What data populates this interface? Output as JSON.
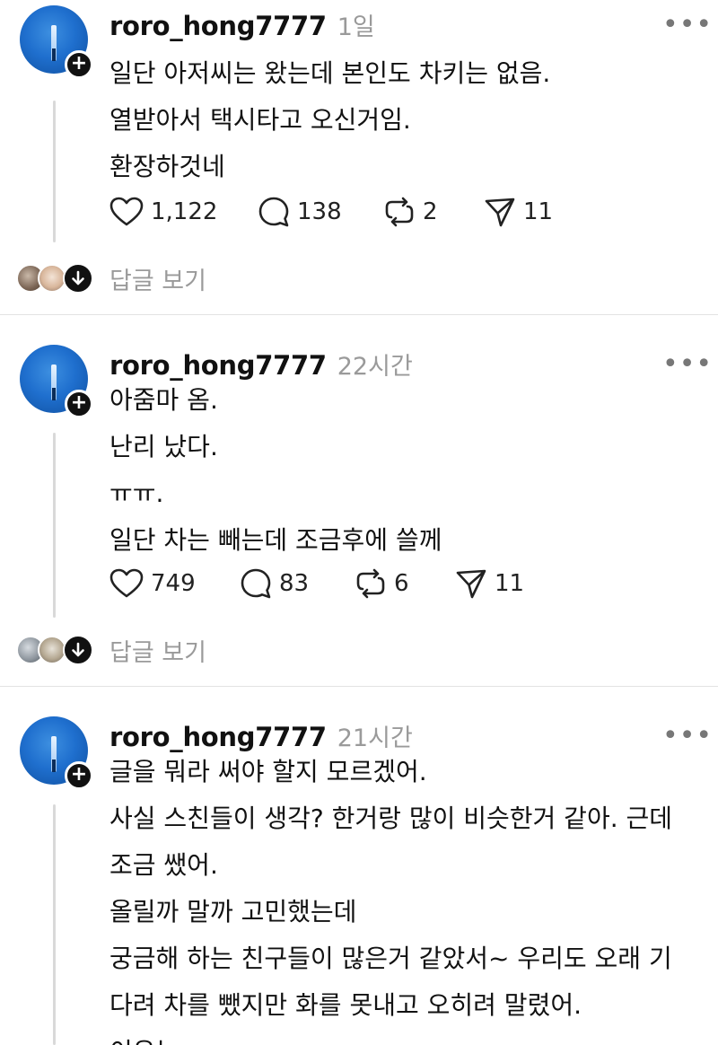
{
  "posts": [
    {
      "username": "roro_hong7777",
      "time": "1일",
      "lines": [
        "일단 아저씨는 왔는데 본인도 차키는 없음.",
        "열받아서 택시타고 오신거임.",
        "환장하것네"
      ],
      "likes": "1,122",
      "comments": "138",
      "reposts": "2",
      "shares": "11",
      "replies_label": "답글 보기"
    },
    {
      "username": "roro_hong7777",
      "time": "22시간",
      "lines": [
        "아줌마 옴.",
        "난리 났다.",
        "ㅠㅠ.",
        "일단 차는 빼는데 조금후에 쓸께"
      ],
      "likes": "749",
      "comments": "83",
      "reposts": "6",
      "shares": "11",
      "replies_label": "답글 보기"
    },
    {
      "username": "roro_hong7777",
      "time": "21시간",
      "lines": [
        "글을 뭐라 써야 할지 모르겠어.",
        "사실 스친들이 생각? 한거랑 많이 비슷한거 같아. 근데",
        "조금 쌨어.",
        "올릴까 말까 고민했는데",
        "궁금해 하는 친구들이 많은거 같았서~ 우리도 오래 기",
        "다려 차를 뺐지만 화를 못내고 오히려 말렸어.",
        "이유는~"
      ]
    }
  ],
  "icons": {
    "more": "more-dots-icon",
    "like": "heart-icon",
    "comment": "comment-bubble-icon",
    "repost": "repost-icon",
    "share": "send-icon",
    "expand": "chevron-down-icon",
    "follow": "plus-icon"
  },
  "colors": {
    "text": "#111111",
    "muted": "#9a9a9a",
    "divider": "#e3e3e3",
    "thread": "#d9d9d9"
  }
}
